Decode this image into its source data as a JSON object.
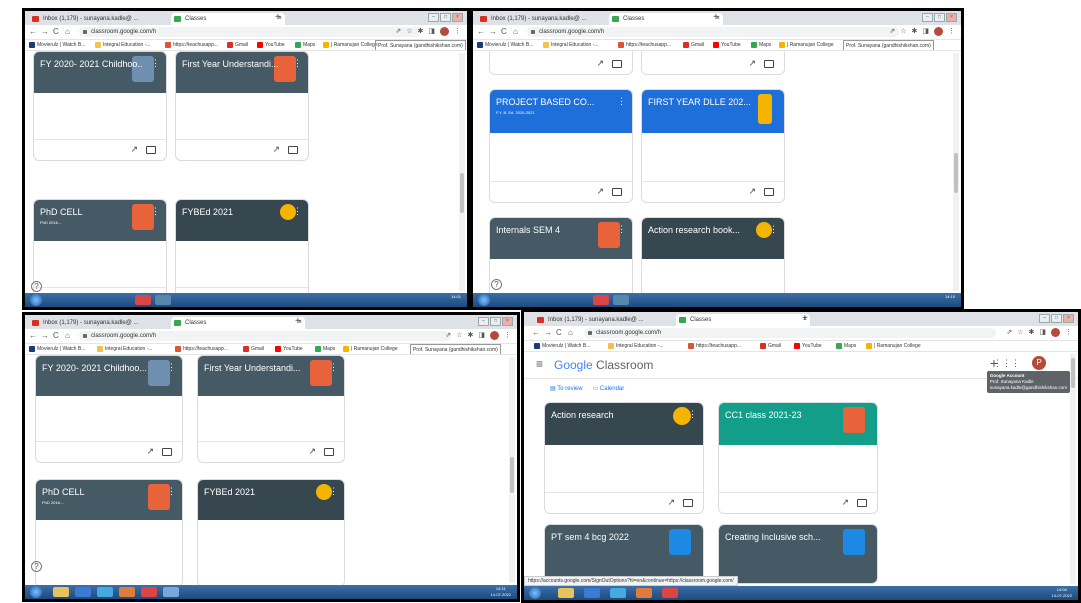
{
  "browser": {
    "tab1_label": "Inbox (1,179) - sunayana.kadle@ ...",
    "tab2_label": "Classes",
    "tab_close": "×",
    "new_tab": "+",
    "url_short": "classroom.google.com/h",
    "url_full": "classroom.google.com/h",
    "bookmarks": [
      {
        "label": "Movierulz | Watch B...",
        "color": "#1a3c7a"
      },
      {
        "label": "Integral Education -...",
        "color": "#f2c14e"
      },
      {
        "label": "https://teachusapp...",
        "color": "#e0533b"
      },
      {
        "label": "Gmail",
        "color": "#d93025"
      },
      {
        "label": "YouTube",
        "color": "#ff0000"
      },
      {
        "label": "Maps",
        "color": "#34a853"
      },
      {
        "label": "| Ramanujan College",
        "color": "#f4b400"
      }
    ],
    "profile_tooltip": "Prof. Sunayana (gandhishikshan.com)"
  },
  "nav_icons": {
    "back": "←",
    "forward": "→",
    "reload": "C",
    "home": "⌂",
    "share": "⇗",
    "star": "☆",
    "ext": "✱",
    "split": "◨",
    "more": "⋮"
  },
  "card_icons": {
    "trend": "↗",
    "menu": "⋮"
  },
  "panel_tl": {
    "cards": [
      {
        "title": "FY 2020- 2021 Childhoo...",
        "subtitle": "",
        "color": "#455a64",
        "illus": "#6f8fb0"
      },
      {
        "title": "First Year Understandi...",
        "subtitle": "",
        "color": "#455a64",
        "illus": "#e8633a"
      },
      {
        "title": "PhD CELL",
        "subtitle": "PhD 2016....",
        "color": "#455a64",
        "illus": "#e8633a"
      },
      {
        "title": "FYBEd 2021",
        "subtitle": "",
        "color": "#37474f",
        "illus": "#f4b400"
      }
    ],
    "time": "14:01"
  },
  "panel_tr": {
    "cards": [
      {
        "title": "PROJECT BASED CO...",
        "subtitle": "F.Y. B. Ed. 2020-2021",
        "color": "#1e6fd9",
        "illus": "#1e6fd9"
      },
      {
        "title": "FIRST YEAR DLLE 202...",
        "subtitle": "",
        "color": "#1e6fd9",
        "illus": "#f4b400"
      },
      {
        "title": "Internals SEM 4",
        "subtitle": "",
        "color": "#455a64",
        "illus": "#e8633a"
      },
      {
        "title": "Action research book...",
        "subtitle": "",
        "color": "#37474f",
        "illus": "#f4b400"
      }
    ],
    "time": "14:15"
  },
  "panel_bl": {
    "cards": [
      {
        "title": "FY 2020- 2021 Childhoo...",
        "subtitle": "",
        "color": "#455a64",
        "illus": "#6f8fb0"
      },
      {
        "title": "First Year Understandi...",
        "subtitle": "",
        "color": "#455a64",
        "illus": "#e8633a"
      },
      {
        "title": "PhD CELL",
        "subtitle": "PhD 2016....",
        "color": "#455a64",
        "illus": "#e8633a"
      },
      {
        "title": "FYBEd 2021",
        "subtitle": "",
        "color": "#37474f",
        "illus": "#f4b400"
      }
    ],
    "time": "14:11",
    "date": "14-07-2022"
  },
  "panel_br": {
    "app_logo_google": "Google",
    "app_logo_classroom": "Classroom",
    "avatar_letter": "P",
    "tooltip_line1": "Google Account",
    "tooltip_line2": "Prof. Sunayana Kadle",
    "tooltip_line3": "sunayana.kadle@gandhishikshan.com",
    "to_review": "To review",
    "calendar": "Calendar",
    "cards": [
      {
        "title": "Action research",
        "subtitle": "",
        "color": "#37474f",
        "illus": "#f4b400"
      },
      {
        "title": "CC1 class 2021-23",
        "subtitle": "",
        "color": "#129e88",
        "illus": "#e8633a"
      },
      {
        "title": "PT sem 4 bcg 2022",
        "subtitle": "",
        "color": "#455a64",
        "illus": "#1e88e5"
      },
      {
        "title": "Creating Inclusive sch...",
        "subtitle": "",
        "color": "#455a64",
        "illus": "#1e88e5"
      }
    ],
    "status_url": "https://accounts.google.com/SignOutOptions?hl=en&continue=https://classroom.google.com/",
    "time": "14:08",
    "date": "14-07-2022"
  }
}
